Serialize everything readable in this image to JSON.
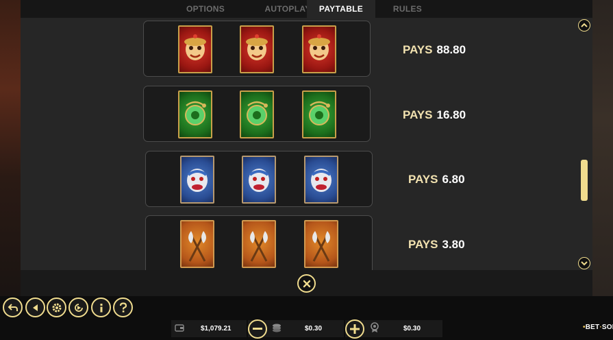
{
  "tabs": [
    {
      "label": "OPTIONS"
    },
    {
      "label": "AUTOPLAY"
    },
    {
      "label": "PAYTABLE"
    },
    {
      "label": "RULES"
    }
  ],
  "active_tab": "PAYTABLE",
  "paytable": {
    "rows": [
      {
        "symbol": "red-monkey-king-mask",
        "color": "#b42318",
        "pays_label": "PAYS",
        "amount": "88.80"
      },
      {
        "symbol": "green-jade-dragon",
        "color": "#1e7a1e",
        "pays_label": "PAYS",
        "amount": "16.80"
      },
      {
        "symbol": "blue-demon-mask",
        "color": "#2a4d94",
        "pays_label": "PAYS",
        "amount": "6.80"
      },
      {
        "symbol": "orange-battle-axes",
        "color": "#c0601c",
        "pays_label": "PAYS",
        "amount": "3.80"
      }
    ]
  },
  "bottom": {
    "balance": "$1,079.21",
    "bet": "$0.30",
    "win": "$0.30",
    "brand_pre": "BET",
    "brand_post": "SOFT"
  },
  "colors": {
    "accent": "#f0dc8e",
    "panel": "#262626",
    "tab_bar": "#161616",
    "pays_label": "#f2e2b0"
  }
}
